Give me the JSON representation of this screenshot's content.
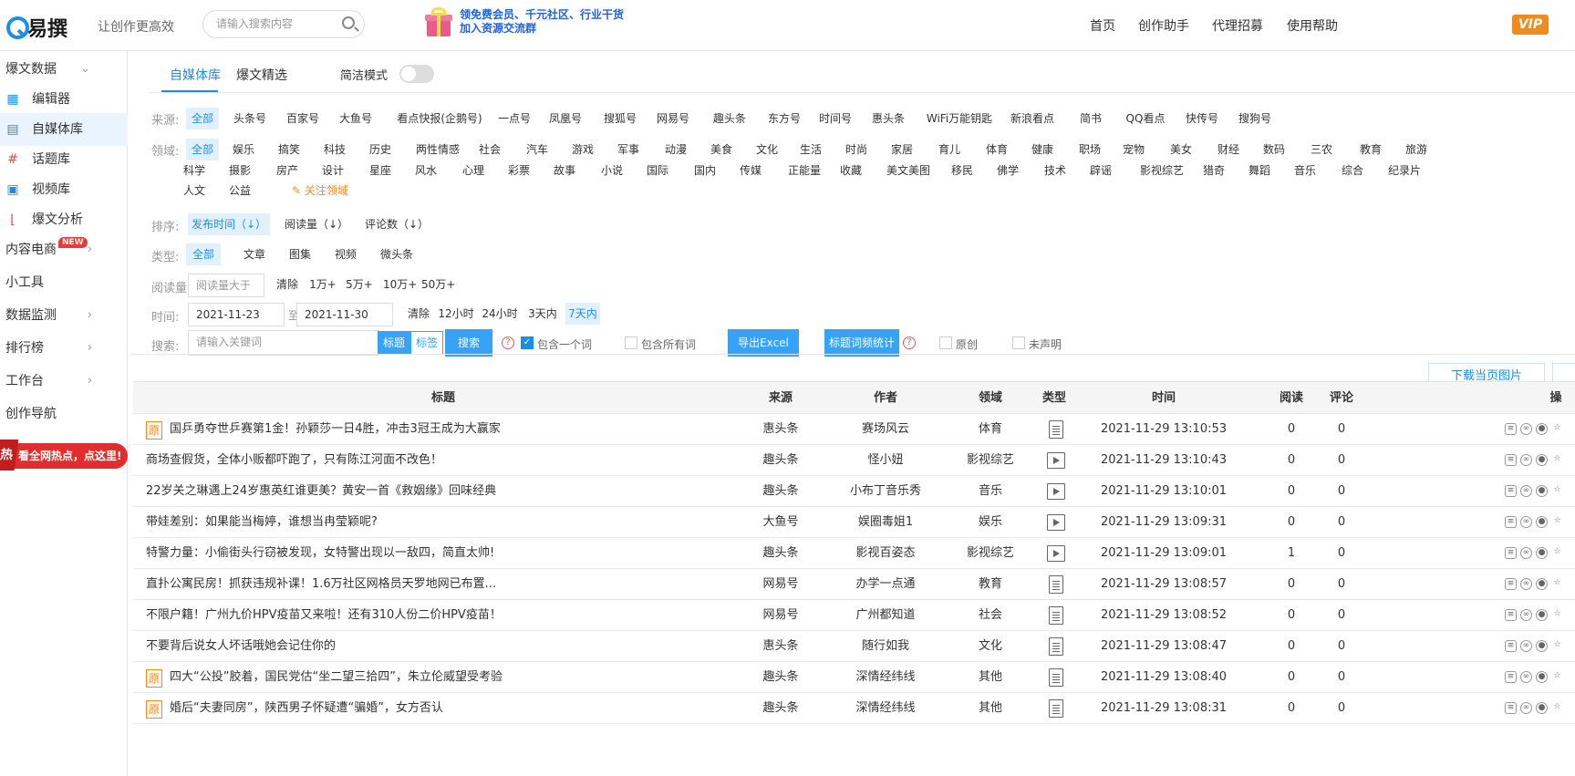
{
  "header": {
    "logo_text": "易撰",
    "slogan": "让创作更高效",
    "search_placeholder": "请输入搜索内容",
    "promo_line1": "领免费会员、千元社区、行业干货",
    "promo_line2": "加入资源交流群",
    "nav": [
      "首页",
      "创作助手",
      "代理招募",
      "使用帮助"
    ],
    "vip": "VIP"
  },
  "sidebar": {
    "items": [
      {
        "label": "爆文数据",
        "icon": "chevron-down-icon"
      },
      {
        "label": "编辑器",
        "icon": "grid-icon"
      },
      {
        "label": "自媒体库",
        "icon": "document-icon"
      },
      {
        "label": "话题库",
        "icon": "hash-icon"
      },
      {
        "label": "视频库",
        "icon": "video-icon"
      },
      {
        "label": "爆文分析",
        "icon": "chart-icon"
      },
      {
        "label": "内容电商",
        "badge": "NEW"
      },
      {
        "label": "小工具"
      },
      {
        "label": "数据监测"
      },
      {
        "label": "排行榜"
      },
      {
        "label": "工作台"
      },
      {
        "label": "创作导航"
      }
    ],
    "hot_badge": "热",
    "hot_text": "看全网热点，点这里!"
  },
  "tabs": [
    "自媒体库",
    "爆文精选"
  ],
  "simple_mode_label": "简洁模式",
  "filters": {
    "source_label": "来源:",
    "sources": [
      "全部",
      "头条号",
      "百家号",
      "大鱼号",
      "看点快报(企鹅号)",
      "一点号",
      "凤凰号",
      "搜狐号",
      "网易号",
      "趣头条",
      "东方号",
      "时间号",
      "惠头条",
      "WiFi万能钥匙",
      "新浪看点",
      "简书",
      "QQ看点",
      "快传号",
      "搜狗号"
    ],
    "domain_label": "领域:",
    "domains_row1": [
      "全部",
      "娱乐",
      "搞笑",
      "科技",
      "历史",
      "两性情感",
      "社会",
      "汽车",
      "游戏",
      "军事",
      "动漫",
      "美食",
      "文化",
      "生活",
      "时尚",
      "家居",
      "育儿",
      "体育",
      "健康",
      "职场",
      "宠物",
      "美女",
      "财经",
      "数码",
      "三农",
      "教育",
      "旅游"
    ],
    "domains_row2": [
      "科学",
      "摄影",
      "房产",
      "设计",
      "星座",
      "风水",
      "心理",
      "彩票",
      "故事",
      "小说",
      "国际",
      "国内",
      "传媒",
      "正能量",
      "收藏",
      "美文美图",
      "移民",
      "佛学",
      "技术",
      "辟谣",
      "影视综艺",
      "猎奇",
      "舞蹈",
      "音乐",
      "综合",
      "纪录片"
    ],
    "domains_row3": [
      "人文",
      "公益"
    ],
    "follow_domain": "关注领域",
    "sort_label": "排序:",
    "sorts": [
      "发布时间（↓）",
      "阅读量（↓）",
      "评论数（↓）"
    ],
    "type_label": "类型:",
    "types": [
      "全部",
      "文章",
      "图集",
      "视频",
      "微头条"
    ],
    "reads_label": "阅读量:",
    "reads_placeholder": "阅读量大于",
    "reads_opts": [
      "清除",
      "1万+",
      "5万+",
      "10万+",
      "50万+"
    ],
    "time_label": "时间:",
    "date_from": "2021-11-23 00:00",
    "date_sep": "至",
    "date_to": "2021-11-30 00:00",
    "time_opts": [
      "清除",
      "12小时",
      "24小时",
      "3天内",
      "7天内"
    ],
    "search_label": "搜索:",
    "search_placeholder": "请输入关键词",
    "search_seg": [
      "标题",
      "标签"
    ],
    "search_btn": "搜索",
    "contains_one": "包含一个词",
    "contains_all": "包含所有词",
    "export_btn": "导出Excel",
    "stats_btn": "标题词频统计",
    "original": "原创",
    "undeclared": "未声明"
  },
  "download_btn": "下载当页图片",
  "table": {
    "headers": [
      "标题",
      "来源",
      "作者",
      "领域",
      "类型",
      "时间",
      "阅读",
      "评论",
      "操"
    ],
    "rows": [
      {
        "orig": true,
        "title": "国乒勇夺世乒赛第1金！孙颖莎一日4胜，冲击3冠王成为大赢家",
        "source": "惠头条",
        "author": "赛场风云",
        "domain": "体育",
        "type": "doc",
        "time": "2021-11-29 13:10:53",
        "reads": "0",
        "comments": "0"
      },
      {
        "orig": false,
        "title": "商场查假货，全体小贩都吓跑了，只有陈江河面不改色！",
        "source": "趣头条",
        "author": "怪小妞",
        "domain": "影视综艺",
        "type": "video",
        "time": "2021-11-29 13:10:43",
        "reads": "0",
        "comments": "0"
      },
      {
        "orig": false,
        "title": "22岁关之琳遇上24岁惠英红谁更美？黄安一首《救姻缘》回味经典",
        "source": "趣头条",
        "author": "小布丁音乐秀",
        "domain": "音乐",
        "type": "video",
        "time": "2021-11-29 13:10:01",
        "reads": "0",
        "comments": "0"
      },
      {
        "orig": false,
        "title": "带娃差别：如果能当梅婷，谁想当冉莹颖呢?",
        "source": "大鱼号",
        "author": "娱圈毒姐1",
        "domain": "娱乐",
        "type": "video",
        "time": "2021-11-29 13:09:31",
        "reads": "0",
        "comments": "0"
      },
      {
        "orig": false,
        "title": "特警力量：小偷街头行窃被发现，女特警出现以一敌四，简直太帅!",
        "source": "趣头条",
        "author": "影视百姿态",
        "domain": "影视综艺",
        "type": "video",
        "time": "2021-11-29 13:09:01",
        "reads": "1",
        "comments": "0"
      },
      {
        "orig": false,
        "title": "直扑公寓民房！抓获违规补课！1.6万社区网格员天罗地网已布置...",
        "source": "网易号",
        "author": "办学一点通",
        "domain": "教育",
        "type": "doc",
        "time": "2021-11-29 13:08:57",
        "reads": "0",
        "comments": "0"
      },
      {
        "orig": false,
        "title": "不限户籍！广州九价HPV疫苗又来啦！还有310人份二价HPV疫苗！",
        "source": "网易号",
        "author": "广州都知道",
        "domain": "社会",
        "type": "doc",
        "time": "2021-11-29 13:08:52",
        "reads": "0",
        "comments": "0"
      },
      {
        "orig": false,
        "title": "不要背后说女人坏话哦她会记住你的",
        "source": "惠头条",
        "author": "随行如我",
        "domain": "文化",
        "type": "doc",
        "time": "2021-11-29 13:08:47",
        "reads": "0",
        "comments": "0"
      },
      {
        "orig": true,
        "title": "四大“公投”胶着，国民党估“坐二望三拾四”，朱立伦威望受考验",
        "source": "趣头条",
        "author": "深情经纬线",
        "domain": "其他",
        "type": "doc",
        "time": "2021-11-29 13:08:40",
        "reads": "0",
        "comments": "0"
      },
      {
        "orig": true,
        "title": "婚后“夫妻同房”，陕西男子怀疑遭“骗婚”，女方否认",
        "source": "趣头条",
        "author": "深情经纬线",
        "domain": "其他",
        "type": "doc",
        "time": "2021-11-29 13:08:31",
        "reads": "0",
        "comments": "0"
      }
    ],
    "orig_mark": "原"
  },
  "colors": {
    "accent": "#1e8fe0",
    "button": "#36a3f7",
    "vip": "#f08b1e",
    "hot": "#e02e2e"
  }
}
